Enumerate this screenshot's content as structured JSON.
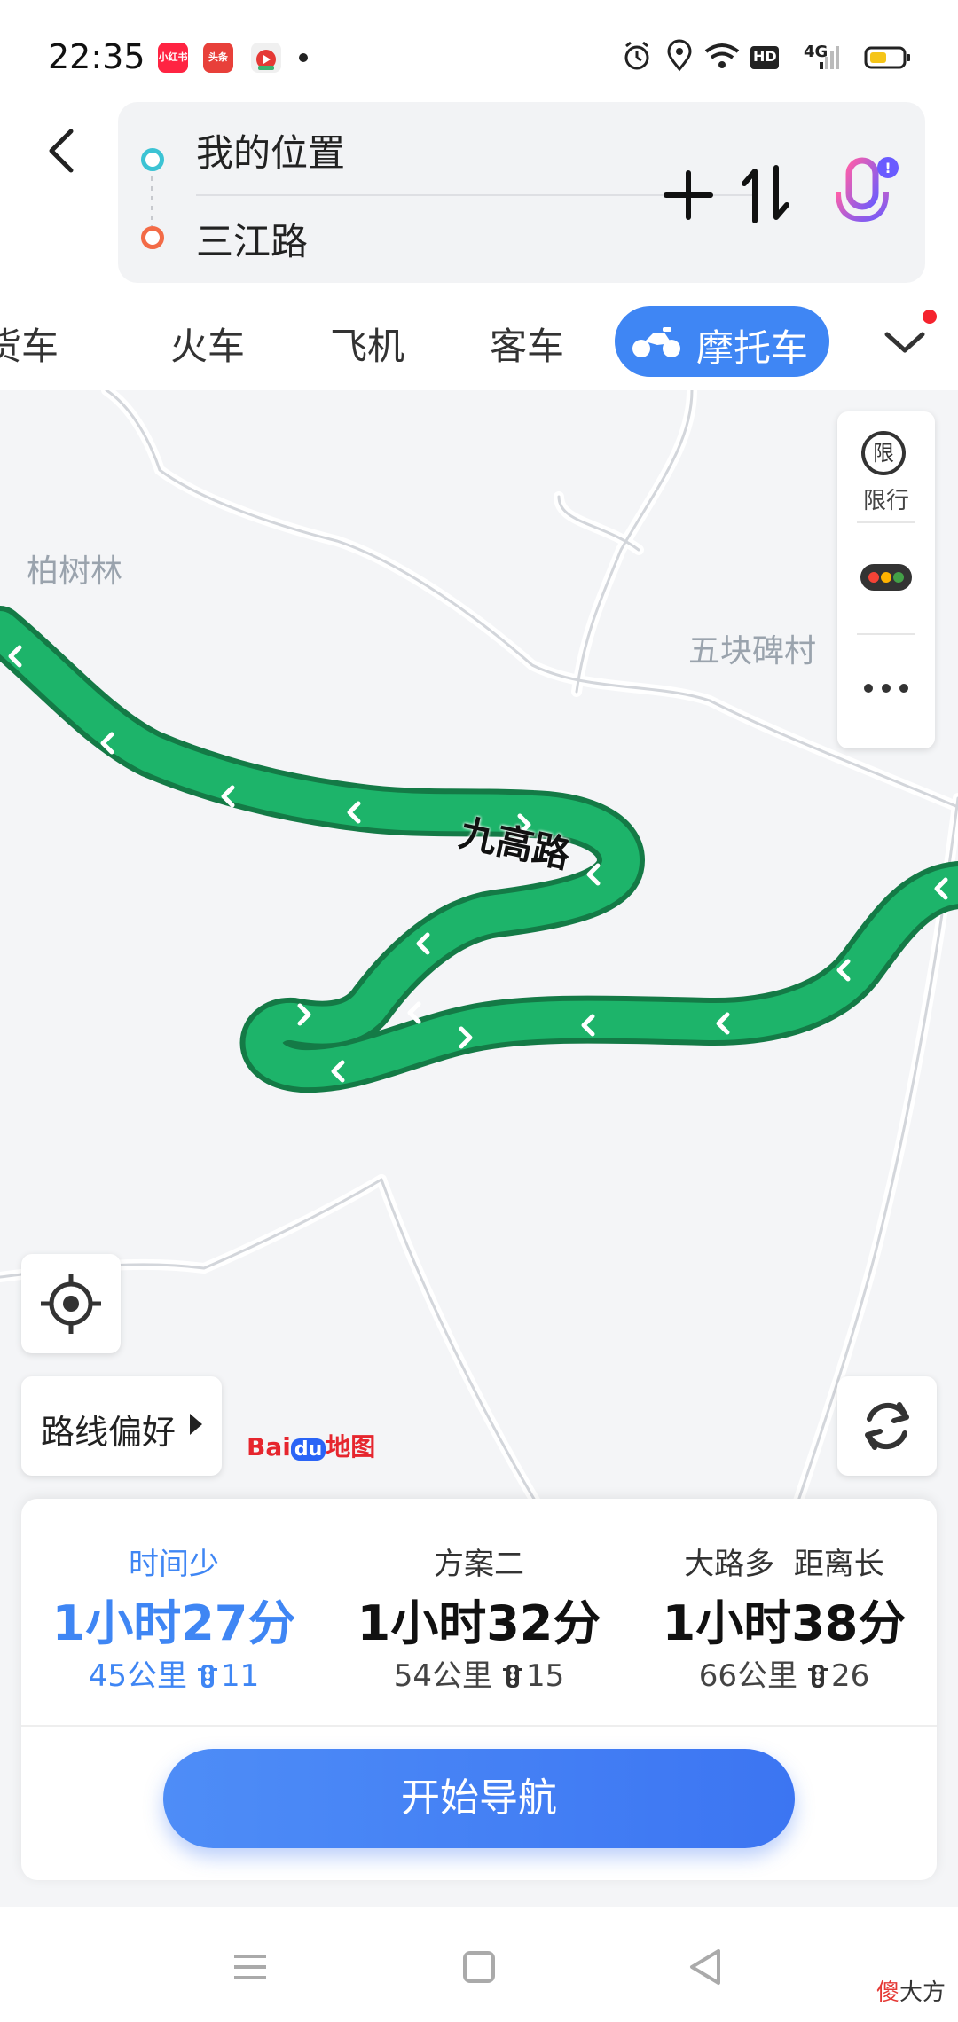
{
  "status_bar": {
    "time": "22:35",
    "app_icons": [
      "小红书",
      "头条",
      "video-app-icon"
    ],
    "indicators": [
      "alarm-icon",
      "location-icon",
      "wifi-icon",
      "HD",
      "4G",
      "signal-icon",
      "battery-icon"
    ],
    "hd_label": "HD",
    "network_label": "4G"
  },
  "route": {
    "origin": "我的位置",
    "destination": "三江路"
  },
  "tabs": {
    "items": [
      "货车",
      "火车",
      "飞机",
      "客车"
    ],
    "active": "摩托车"
  },
  "map": {
    "place_labels": [
      "柏树林",
      "五块碑村"
    ],
    "road_label": "九高路",
    "side_panel": {
      "restriction_glyph": "限",
      "restriction_label": "限行"
    },
    "route_preference": "路线偏好",
    "logo": {
      "bai": "Bai",
      "du": "du",
      "map": "地图"
    },
    "route_color": "#1db46a"
  },
  "plans": [
    {
      "tag": "时间少",
      "time": "1小时27分",
      "distance": "45公里",
      "lights": "11",
      "selected": true
    },
    {
      "tag": "方案二",
      "time": "1小时32分",
      "distance": "54公里",
      "lights": "15",
      "selected": false
    },
    {
      "tag": "大路多  距离长",
      "time": "1小时38分",
      "distance": "66公里",
      "lights": "26",
      "selected": false
    }
  ],
  "actions": {
    "start_navigation": "开始导航"
  },
  "watermark": {
    "first": "傻",
    "rest": "大方"
  },
  "colors": {
    "accent": "#3f86f4",
    "route_green": "#1db46a",
    "alert_red": "#f5232e"
  }
}
